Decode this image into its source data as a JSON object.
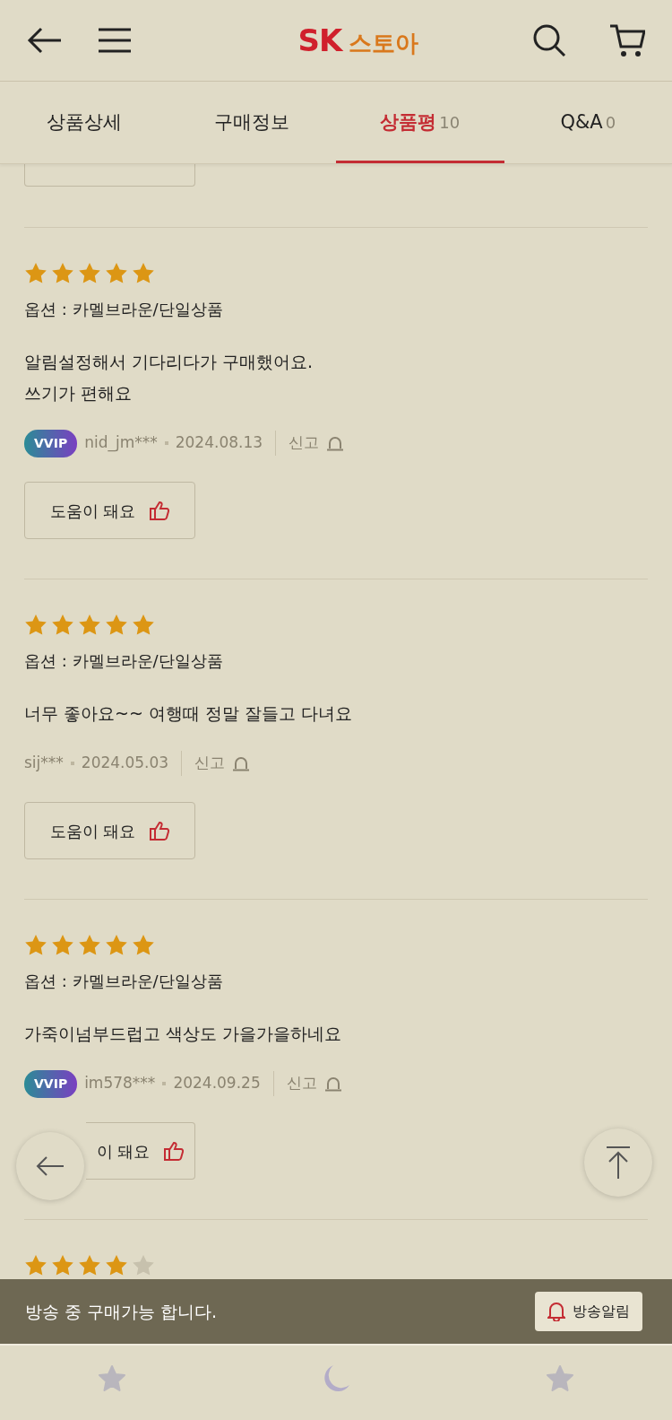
{
  "header": {
    "logo_mark": "SK",
    "logo_text": "스토아"
  },
  "tabs": [
    {
      "label": "상품상세",
      "selected": false
    },
    {
      "label": "구매정보",
      "selected": false
    },
    {
      "label": "상품평",
      "count": "10",
      "selected": true
    },
    {
      "label": "Q&A",
      "count": "0",
      "selected": false
    }
  ],
  "reviews": [
    {
      "stars": 5,
      "option": "옵션 : 카멜브라운/단일상품",
      "text": [
        "알림설정해서 기다리다가 구매했어요.",
        "쓰기가 편해요"
      ],
      "badge": "VVIP",
      "user": "nid_jm***",
      "date": "2024.08.13",
      "report": "신고",
      "helpful": "도움이 돼요"
    },
    {
      "stars": 5,
      "option": "옵션 : 카멜브라운/단일상품",
      "text": [
        "너무 좋아요~~ 여행때 정말 잘들고 다녀요"
      ],
      "user": "sij***",
      "date": "2024.05.03",
      "report": "신고",
      "helpful": "도움이 돼요"
    },
    {
      "stars": 5,
      "option": "옵션 : 카멜브라운/단일상품",
      "text": [
        "가죽이넘부드럽고 색상도 가을가을하네요"
      ],
      "badge": "VVIP",
      "user": "im578***",
      "date": "2024.09.25",
      "report": "신고",
      "helpful": "이 돼요",
      "helpful_covered": true
    },
    {
      "stars": 4
    }
  ],
  "banner": {
    "text": "방송 중 구매가능 합니다.",
    "button": "방송알림"
  }
}
